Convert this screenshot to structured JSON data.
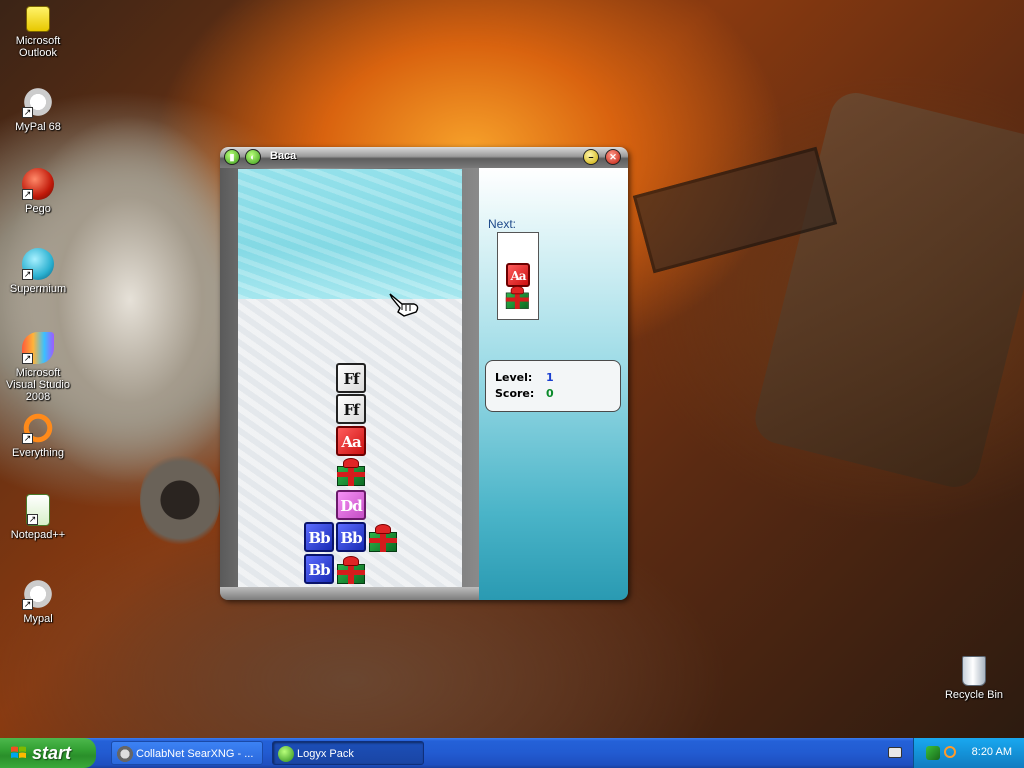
{
  "desktop": {
    "icons": [
      {
        "label": "Microsoft Outlook",
        "icon": "outlook-icon"
      },
      {
        "label": "MyPal 68",
        "icon": "mypal-icon"
      },
      {
        "label": "Pego",
        "icon": "pego-icon"
      },
      {
        "label": "Supermium",
        "icon": "supermium-icon"
      },
      {
        "label": "Microsoft Visual Studio 2008",
        "icon": "visual-studio-icon"
      },
      {
        "label": "Everything",
        "icon": "everything-icon"
      },
      {
        "label": "Notepad++",
        "icon": "notepad-plus-plus-icon"
      },
      {
        "label": "Mypal",
        "icon": "mypal-icon"
      },
      {
        "label": "Recycle Bin",
        "icon": "recycle-bin-icon"
      }
    ]
  },
  "window": {
    "title": "Baca",
    "next_label": "Next:",
    "level_label": "Level:",
    "level_value": "1",
    "score_label": "Score:",
    "score_value": "0",
    "colors": {
      "level": "#1a3fd0",
      "score": "#0a8a2a"
    }
  },
  "blocks": {
    "field": [
      "Ff",
      "Ff",
      "Aa",
      "gift",
      "Dd",
      "Bb",
      "Bb",
      "gift",
      "Bb",
      "gift"
    ],
    "next": [
      "Aa",
      "gift"
    ]
  },
  "taskbar": {
    "start_label": "start",
    "tasks": [
      {
        "label": "CollabNet SearXNG - ...",
        "active": false
      },
      {
        "label": "Logyx Pack",
        "active": true
      }
    ],
    "clock": "8:20 AM"
  }
}
